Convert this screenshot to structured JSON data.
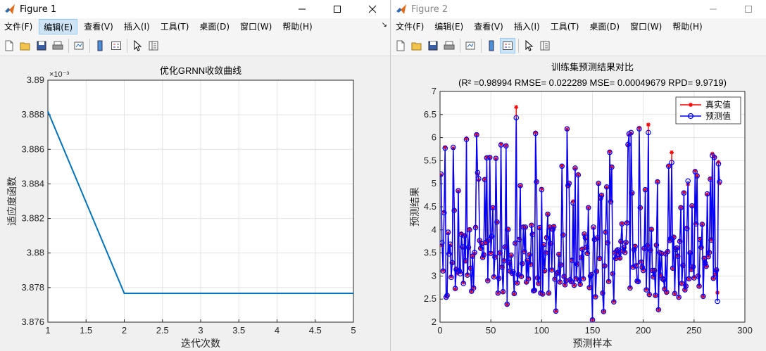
{
  "windows": [
    {
      "title": "Figure 1",
      "menus": [
        "文件(F)",
        "编辑(E)",
        "查看(V)",
        "插入(I)",
        "工具(T)",
        "桌面(D)",
        "窗口(W)",
        "帮助(H)"
      ],
      "active_menu": "编辑(E)"
    },
    {
      "title": "Figure 2",
      "menus": [
        "文件(F)",
        "编辑(E)",
        "查看(V)",
        "插入(I)",
        "工具(T)",
        "桌面(D)",
        "窗口(W)",
        "帮助(H)"
      ]
    }
  ],
  "icons": {
    "minimize": "minimize-icon",
    "maximize": "maximize-icon",
    "close": "close-icon",
    "app": "matlab-icon"
  },
  "colors": {
    "line1": "#0072BD",
    "actual": "#FF0000",
    "predicted": "#0000FF",
    "marker_fill": "#8B1A8B"
  },
  "chart_data": [
    {
      "type": "line",
      "title": "优化GRNN收敛曲线",
      "xlabel": "迭代次数",
      "ylabel": "适应度函数",
      "y_exponent": "×10⁻³",
      "xlim": [
        1,
        5
      ],
      "ylim": [
        3.876,
        3.89
      ],
      "x_ticks": [
        "1",
        "1.5",
        "2",
        "2.5",
        "3",
        "3.5",
        "4",
        "4.5",
        "5"
      ],
      "y_ticks": [
        "3.876",
        "3.878",
        "3.88",
        "3.882",
        "3.884",
        "3.886",
        "3.888",
        "3.89"
      ],
      "x": [
        1,
        2,
        3,
        4,
        5
      ],
      "values": [
        3.8882,
        3.87767,
        3.87767,
        3.87767,
        3.87767
      ],
      "grid": true
    },
    {
      "type": "line",
      "title": "训练集预测结果对比",
      "subtitle": "(R² =0.98994 RMSE= 0.022289 MSE= 0.00049679 RPD= 9.9719)",
      "xlabel": "预测样本",
      "ylabel": "预测结果",
      "xlim": [
        0,
        300
      ],
      "ylim": [
        2,
        7
      ],
      "x_ticks": [
        "0",
        "50",
        "100",
        "150",
        "200",
        "250",
        "300"
      ],
      "y_ticks": [
        "2",
        "2.5",
        "3",
        "3.5",
        "4",
        "4.5",
        "5",
        "5.5",
        "6",
        "6.5",
        "7"
      ],
      "legend_position": "top-right",
      "grid": true,
      "series": [
        {
          "name": "真实值",
          "values": [
            5.19,
            3.67,
            3.12,
            4.39,
            5.79,
            2.55,
            2.57,
            3.93,
            3.51,
            3.67,
            2.99,
            3.28,
            5.77,
            4.43,
            2.72,
            3.16,
            3.06,
            4.84,
            3.09,
            3.08,
            3.92,
            3.61,
            2.86,
            3.88,
            3.32,
            5.98,
            3.03,
            3.6,
            4.01,
            3.17,
            2.67,
            3.43,
            2.75,
            3.49,
            4.07,
            6.07,
            5.21,
            5.08,
            3.76,
            3.6,
            3.69,
            3.41,
            3.47,
            5.1,
            3.72,
            5.57,
            2.91,
            3.77,
            5.57,
            3.5,
            3.84,
            4.48,
            2.99,
            3.42,
            5.54,
            4.17,
            2.63,
            2.95,
            3.5,
            5.86,
            3.2,
            2.65,
            3.34,
            3.63,
            5.83,
            2.38,
            4.01,
            3.28,
            3.1,
            3.44,
            3.06,
            3.08,
            2.61,
            3.71,
            6.66,
            2.85,
            3.02,
            3.81,
            4.95,
            2.99,
            3.27,
            4.07,
            3.54,
            4.05,
            2.86,
            3.33,
            2.95,
            3.46,
            3.26,
            4.11,
            3.92,
            2.69,
            2.69,
            6.11,
            5.04,
            2.96,
            2.84,
            4.04,
            2.63,
            4.89,
            2.6,
            3.67,
            3.1,
            3.51,
            3.85,
            4.34,
            2.62,
            4.06,
            3.7,
            3.14,
            4.01,
            4.08,
            2.94,
            2.24,
            3.05,
            3.08,
            3.47,
            2.87,
            3.24,
            5.39,
            3.89,
            2.99,
            2.81,
            2.9,
            6.18,
            4.96,
            5.0,
            2.92,
            2.87,
            3.35,
            4.62,
            2.8,
            5.33,
            2.95,
            3.26,
            5.2,
            2.92,
            2.82,
            3.4,
            3.59,
            2.95,
            3.9,
            3.81,
            3.61,
            3.5,
            4.48,
            2.75,
            3.01,
            3.03,
            2.06,
            4.04,
            3.8,
            2.56,
            3.1,
            3.82,
            5.0,
            3.38,
            4.67,
            4.75,
            2.63,
            2.23,
            3.22,
            3.95,
            4.92,
            3.73,
            2.89,
            5.7,
            4.62,
            5.37,
            3.05,
            2.45,
            3.51,
            3.38,
            3.56,
            3.56,
            3.48,
            3.38,
            3.74,
            4.14,
            3.54,
            3.61,
            3.52,
            3.72,
            4.16,
            5.83,
            6.06,
            2.75,
            6.09,
            4.79,
            3.2,
            3.57,
            3.65,
            3.24,
            2.89,
            2.88,
            6.21,
            4.48,
            3.31,
            3.19,
            3.13,
            3.59,
            4.87,
            2.71,
            3.66,
            6.28,
            2.6,
            3.56,
            4.01,
            3.12,
            2.99,
            3.12,
            2.57,
            3.67,
            5.05,
            2.27,
            3.51,
            3.02,
            3.48,
            2.94,
            2.91,
            2.72,
            3.49,
            2.64,
            3.54,
            5.39,
            3.77,
            3.81,
            5.68,
            3.16,
            3.85,
            2.62,
            3.59,
            3.61,
            3.44,
            2.54,
            3.76,
            4.49,
            2.84,
            3.22,
            4.81,
            2.7,
            2.78,
            4.05,
            4.99,
            2.94,
            3.51,
            3.14,
            4.51,
            3.21,
            2.97,
            5.28,
            4.14,
            5.17,
            3.0,
            2.78,
            3.8,
            3.61,
            4.12,
            2.56,
            3.39,
            3.28,
            3.21,
            4.77,
            3.43,
            3.52,
            5.11,
            3.79,
            5.65,
            2.95,
            5.58,
            3.04,
            3.13,
            2.64,
            5.47,
            5.01
          ]
        },
        {
          "name": "预测值",
          "values": [
            5.21,
            3.72,
            3.11,
            4.37,
            5.77,
            2.54,
            2.58,
            3.95,
            3.48,
            3.69,
            2.97,
            3.29,
            5.79,
            4.42,
            2.73,
            3.14,
            3.09,
            4.85,
            3.11,
            3.05,
            3.9,
            3.63,
            2.84,
            3.87,
            3.33,
            5.96,
            3.02,
            3.62,
            4.0,
            3.17,
            2.67,
            3.43,
            2.74,
            3.51,
            4.05,
            6.06,
            5.24,
            5.11,
            3.77,
            3.6,
            3.7,
            3.4,
            3.46,
            5.09,
            3.73,
            5.56,
            2.9,
            3.78,
            5.57,
            3.49,
            3.86,
            4.48,
            2.98,
            3.41,
            5.55,
            4.17,
            2.63,
            2.95,
            3.5,
            5.84,
            3.19,
            2.66,
            3.33,
            3.63,
            5.82,
            2.39,
            4.01,
            3.29,
            3.11,
            3.45,
            3.06,
            3.09,
            2.62,
            3.71,
            6.43,
            2.85,
            3.03,
            3.79,
            4.96,
            2.99,
            3.27,
            4.06,
            3.53,
            4.06,
            2.87,
            3.34,
            2.94,
            3.46,
            3.25,
            4.1,
            3.9,
            2.68,
            2.69,
            6.09,
            5.04,
            2.96,
            2.84,
            4.05,
            2.63,
            4.87,
            2.61,
            3.68,
            3.12,
            3.5,
            3.83,
            4.34,
            2.63,
            4.06,
            3.7,
            3.13,
            4.01,
            4.07,
            2.93,
            2.24,
            3.05,
            3.08,
            3.47,
            2.87,
            3.24,
            5.38,
            3.89,
            2.99,
            2.81,
            2.9,
            6.19,
            4.96,
            5.01,
            2.92,
            2.88,
            3.34,
            4.58,
            2.8,
            5.34,
            2.94,
            3.26,
            5.19,
            2.91,
            2.82,
            3.4,
            3.58,
            2.94,
            3.91,
            3.83,
            3.62,
            3.49,
            4.48,
            2.75,
            3.0,
            3.03,
            2.05,
            4.06,
            3.79,
            2.55,
            3.1,
            3.83,
            5.01,
            3.38,
            4.69,
            4.75,
            2.63,
            2.23,
            3.22,
            3.95,
            4.93,
            3.72,
            2.88,
            5.68,
            4.61,
            5.36,
            3.05,
            2.44,
            3.5,
            3.38,
            3.55,
            3.57,
            3.47,
            3.39,
            3.75,
            4.13,
            3.54,
            3.62,
            3.51,
            3.73,
            4.15,
            5.85,
            6.08,
            2.74,
            6.11,
            4.8,
            3.19,
            3.57,
            3.64,
            3.22,
            2.89,
            2.88,
            6.19,
            4.48,
            3.3,
            3.19,
            3.12,
            3.6,
            4.87,
            2.7,
            3.66,
            6.11,
            2.6,
            3.56,
            4.01,
            3.12,
            2.98,
            3.12,
            2.58,
            3.67,
            5.04,
            2.27,
            3.51,
            3.02,
            3.49,
            2.94,
            2.92,
            2.72,
            3.48,
            2.65,
            3.53,
            5.38,
            3.77,
            3.81,
            5.46,
            3.17,
            3.84,
            2.62,
            3.58,
            3.61,
            3.43,
            2.54,
            3.75,
            4.48,
            2.84,
            3.23,
            4.8,
            2.7,
            2.78,
            4.03,
            5.06,
            2.94,
            3.5,
            3.14,
            4.52,
            3.2,
            2.96,
            5.26,
            4.13,
            5.17,
            3.0,
            2.78,
            3.79,
            3.62,
            4.12,
            2.56,
            3.38,
            3.28,
            3.21,
            4.78,
            3.42,
            3.51,
            5.1,
            3.78,
            5.61,
            2.95,
            5.57,
            3.05,
            3.13,
            2.45,
            5.43,
            5.04
          ]
        }
      ]
    }
  ]
}
